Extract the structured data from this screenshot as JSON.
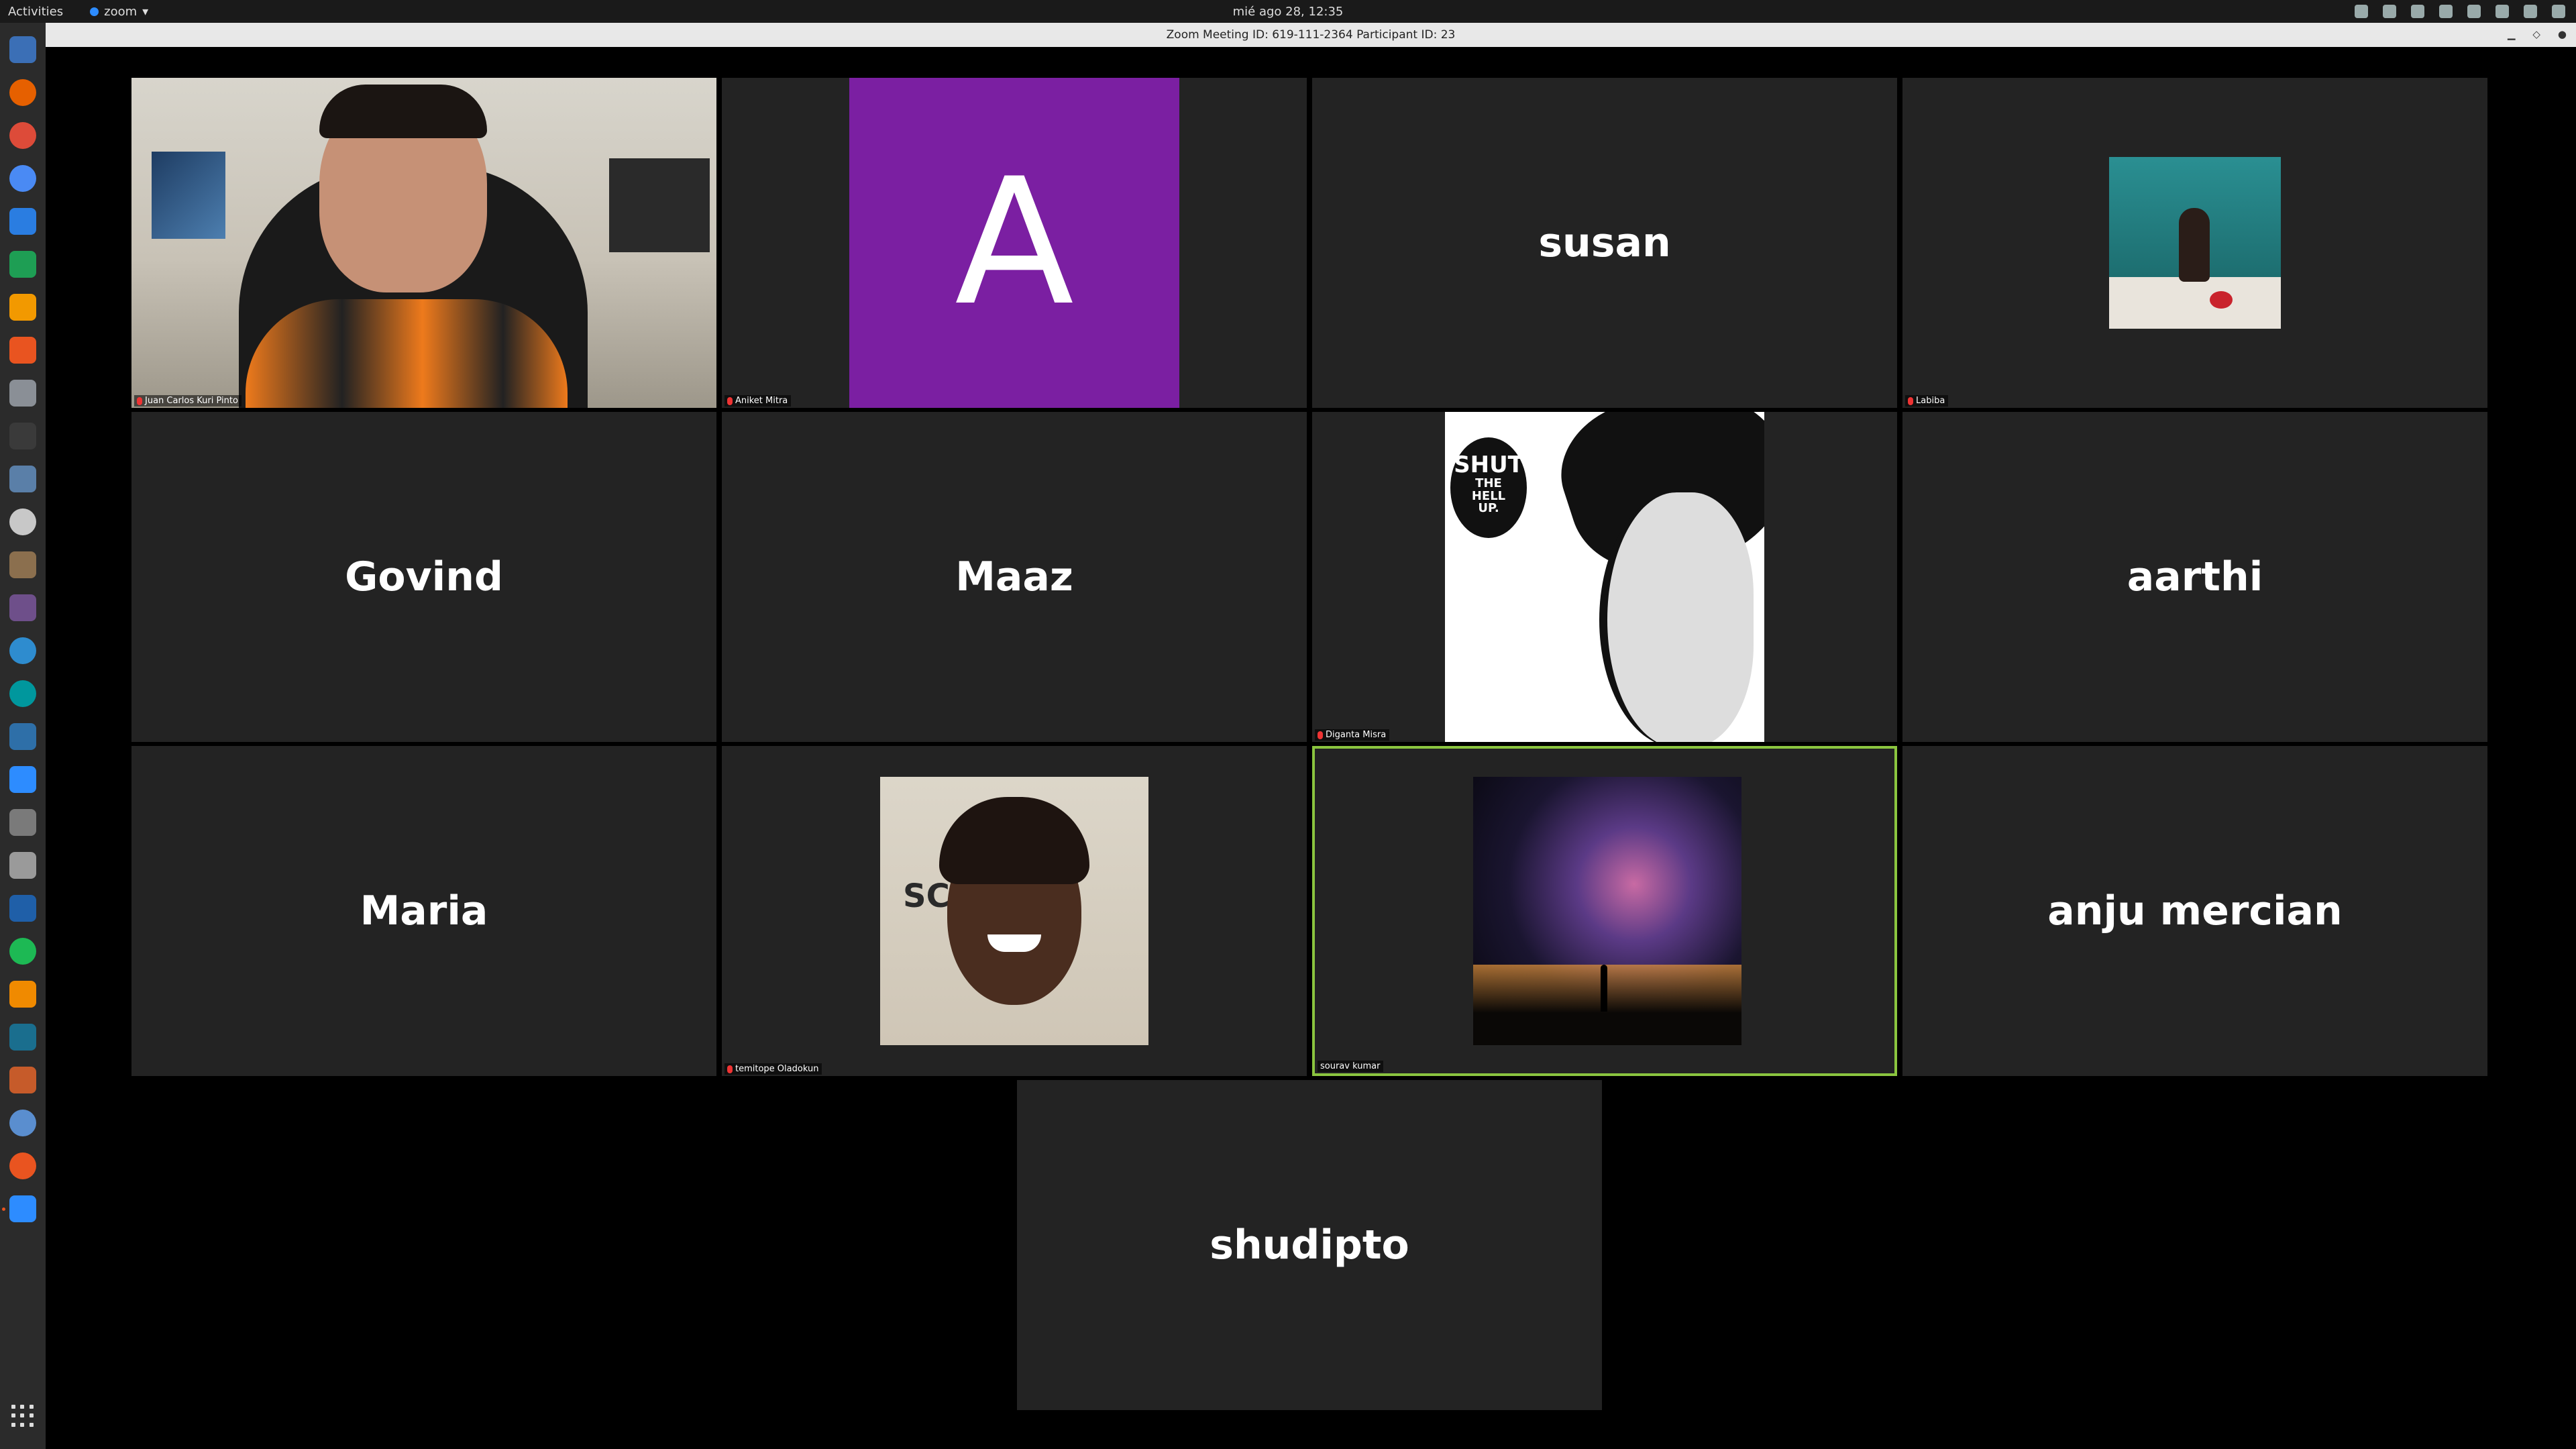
{
  "topbar": {
    "activities": "Activities",
    "app_menu": "zoom",
    "clock": "mié ago 28, 12:35"
  },
  "window": {
    "title": "Zoom Meeting ID: 619-111-2364 Participant ID: 23"
  },
  "dock": {
    "apps": [
      "files-icon",
      "firefox-icon",
      "chrome-icon",
      "chromium-icon",
      "docs-icon",
      "sheets-icon",
      "slides-icon",
      "software-center-icon",
      "tools-icon",
      "terminal-icon",
      "text-editor-icon",
      "disks-icon",
      "gimp-icon",
      "video-editor-icon",
      "browser-icon",
      "arduino-icon",
      "git-icon",
      "zoom-icon",
      "calculator-icon",
      "mixer-icon",
      "virtualbox-icon",
      "spotify-icon",
      "vlc-icon",
      "ide-icon",
      "games-icon",
      "globe-icon",
      "ubuntu-icon",
      "zoom-running-icon"
    ],
    "show_apps": "show-apps-icon"
  },
  "participants": [
    {
      "id": "juan",
      "display": "video",
      "label": "Juan Carlos Kuri Pinto",
      "muted": true
    },
    {
      "id": "aniket",
      "display": "avatar-letter",
      "avatar_letter": "A",
      "avatar_color": "#7b1fa2",
      "label": "Aniket Mitra",
      "muted": true
    },
    {
      "id": "susan",
      "display": "name",
      "name": "susan"
    },
    {
      "id": "labiba",
      "display": "photo",
      "label": "Labiba",
      "muted": true
    },
    {
      "id": "govind",
      "display": "name",
      "name": "Govind"
    },
    {
      "id": "maaz",
      "display": "name",
      "name": "Maaz"
    },
    {
      "id": "diganta",
      "display": "photo",
      "label": "Diganta Misra",
      "muted": true,
      "bubble_line1": "SHUT",
      "bubble_line2": "THE",
      "bubble_line3": "HELL",
      "bubble_line4": "UP."
    },
    {
      "id": "aarthi",
      "display": "name",
      "name": "aarthi"
    },
    {
      "id": "maria",
      "display": "name",
      "name": "Maria"
    },
    {
      "id": "temitope",
      "display": "photo",
      "label": "temitope Oladokun",
      "muted": true,
      "sign_text": "SC"
    },
    {
      "id": "sourav",
      "display": "photo",
      "label": "sourav kumar",
      "muted": false,
      "active_speaker": true
    },
    {
      "id": "anju",
      "display": "name",
      "name": "anju mercian"
    },
    {
      "id": "shudipto",
      "display": "name",
      "name": "shudipto"
    }
  ],
  "colors": {
    "active_speaker_border": "#8bc53f",
    "tile_background": "#232323"
  }
}
